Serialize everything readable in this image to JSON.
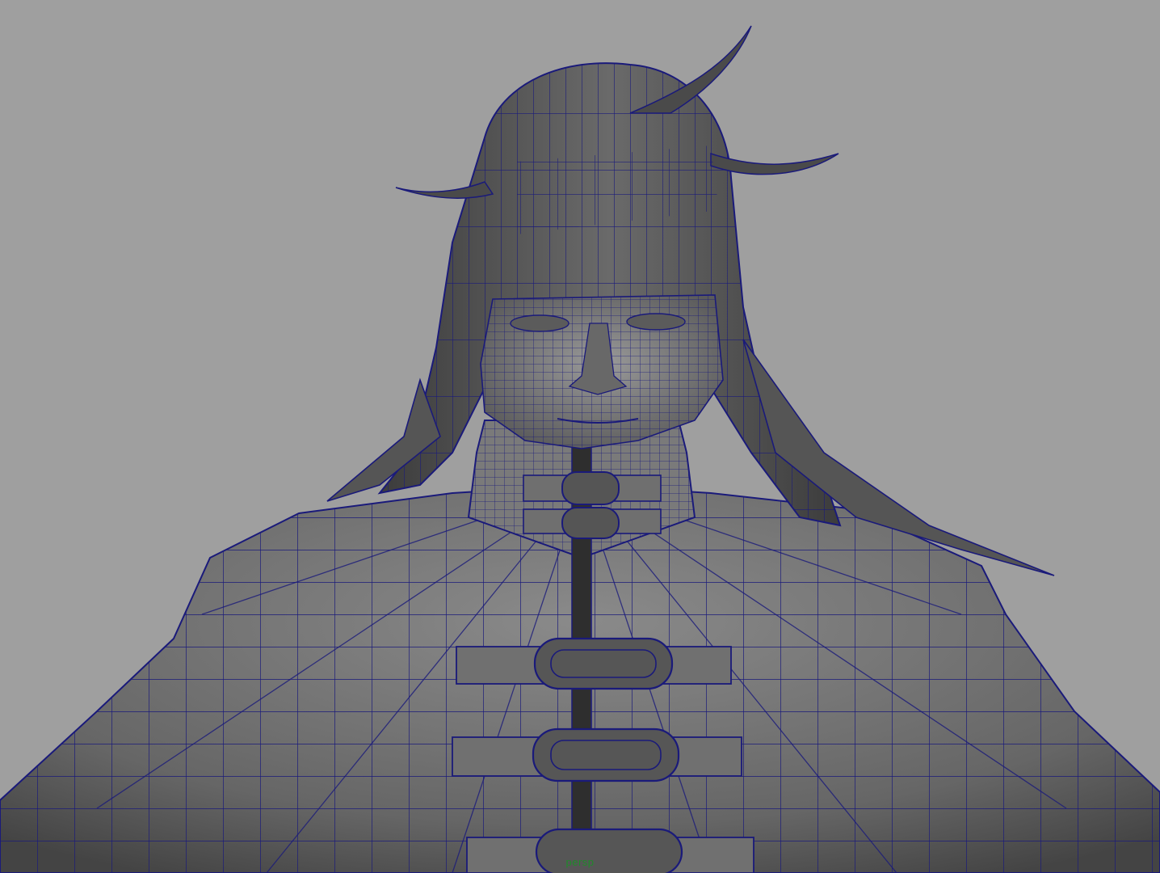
{
  "viewport": {
    "camera_name": "persp"
  },
  "colors": {
    "background": "#9f9f9f",
    "mesh_shade": "#6b6b6b",
    "mesh_dark": "#3a3a3a",
    "wireframe": "#1a1a7a",
    "camera_label": "#1f8a2a"
  },
  "scene": {
    "object": "character-mesh",
    "display_mode": "wireframe-on-shaded"
  }
}
